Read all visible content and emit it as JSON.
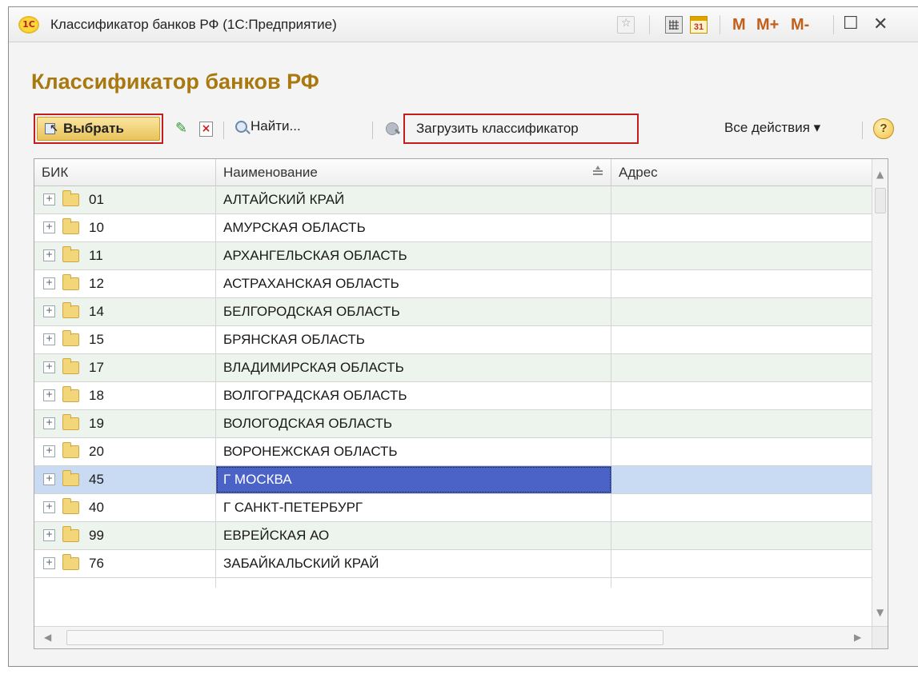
{
  "window": {
    "title": "Классификатор банков РФ  (1С:Предприятие)",
    "logo_text": "1С",
    "calendar_day": "31",
    "memory_buttons": [
      "M",
      "M+",
      "M-"
    ],
    "maximize_symbol": "☐",
    "close_symbol": "✕"
  },
  "page": {
    "heading": "Классификатор банков РФ"
  },
  "toolbar": {
    "select_label": "Выбрать",
    "find_label": "Найти...",
    "load_label": "Загрузить классификатор",
    "all_actions_label": "Все действия ▾",
    "help_symbol": "?"
  },
  "table": {
    "columns": [
      "БИК",
      "Наименование",
      "Адрес"
    ],
    "rows": [
      {
        "code": "01",
        "name": "АЛТАЙСКИЙ КРАЙ",
        "address": ""
      },
      {
        "code": "10",
        "name": "АМУРСКАЯ ОБЛАСТЬ",
        "address": ""
      },
      {
        "code": "11",
        "name": "АРХАНГЕЛЬСКАЯ ОБЛАСТЬ",
        "address": ""
      },
      {
        "code": "12",
        "name": "АСТРАХАНСКАЯ ОБЛАСТЬ",
        "address": ""
      },
      {
        "code": "14",
        "name": "БЕЛГОРОДСКАЯ ОБЛАСТЬ",
        "address": ""
      },
      {
        "code": "15",
        "name": "БРЯНСКАЯ ОБЛАСТЬ",
        "address": ""
      },
      {
        "code": "17",
        "name": "ВЛАДИМИРСКАЯ ОБЛАСТЬ",
        "address": ""
      },
      {
        "code": "18",
        "name": "ВОЛГОГРАДСКАЯ ОБЛАСТЬ",
        "address": ""
      },
      {
        "code": "19",
        "name": "ВОЛОГОДСКАЯ ОБЛАСТЬ",
        "address": ""
      },
      {
        "code": "20",
        "name": "ВОРОНЕЖСКАЯ ОБЛАСТЬ",
        "address": ""
      },
      {
        "code": "45",
        "name": "Г МОСКВА",
        "address": ""
      },
      {
        "code": "40",
        "name": "Г САНКТ-ПЕТЕРБУРГ",
        "address": ""
      },
      {
        "code": "99",
        "name": "ЕВРЕЙСКАЯ АО",
        "address": ""
      },
      {
        "code": "76",
        "name": "ЗАБАЙКАЛЬСКИЙ КРАЙ",
        "address": ""
      }
    ],
    "selected_row_index": 10
  },
  "colors": {
    "heading": "#a9780e",
    "highlight_border": "#c31d1d",
    "selected_cell": "#4b63c7",
    "selected_row": "#c9dbf2",
    "alt_row": "#edf3ed"
  },
  "icons": [
    "1c-logo-icon",
    "favorite-star-icon",
    "calculator-icon",
    "calendar-icon",
    "select-icon",
    "pencil-edit-icon",
    "delete-x-icon",
    "search-magnifier-icon",
    "load-classifier-icon",
    "help-icon",
    "expand-plus-icon",
    "folder-icon",
    "sort-icon"
  ]
}
